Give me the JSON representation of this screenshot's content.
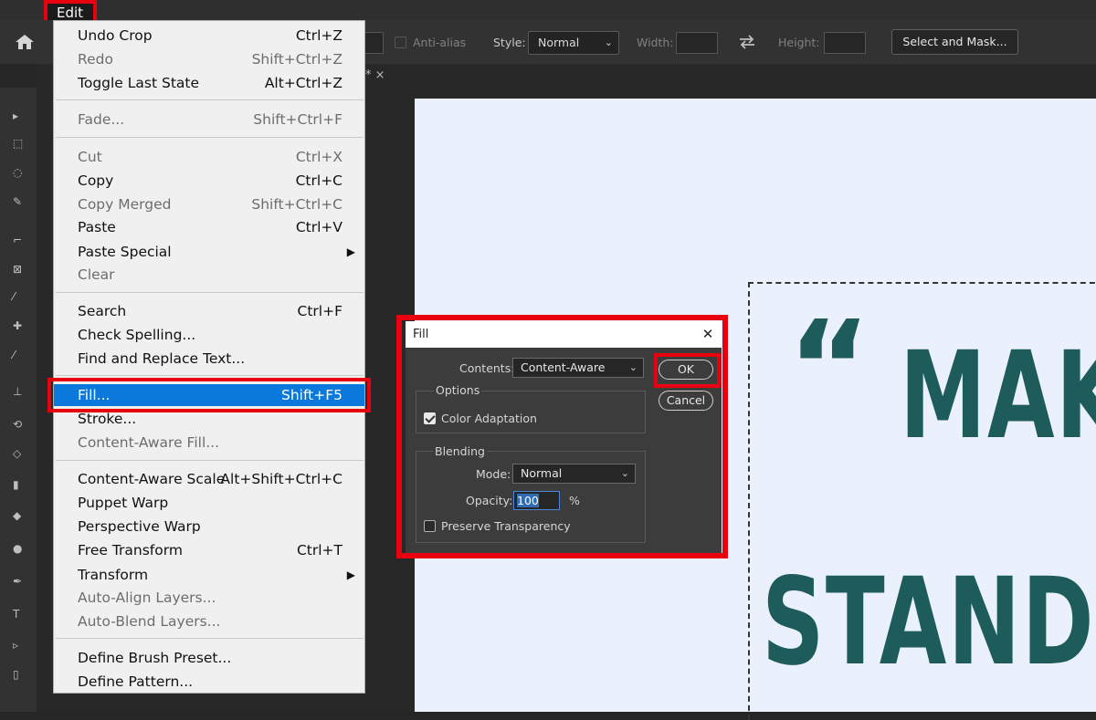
{
  "menubar": {
    "edit_label": "Edit"
  },
  "options_bar": {
    "anti_alias_label": "Anti-alias",
    "style_label": "Style:",
    "style_value": "Normal",
    "width_label": "Width:",
    "height_label": "Height:",
    "select_mask_label": "Select and Mask..."
  },
  "tabbar": {
    "stub": "* ×"
  },
  "edit_menu": {
    "items": [
      {
        "label": "Undo Crop",
        "shortcut": "Ctrl+Z",
        "enabled": true
      },
      {
        "label": "Redo",
        "shortcut": "Shift+Ctrl+Z",
        "enabled": false
      },
      {
        "label": "Toggle Last State",
        "shortcut": "Alt+Ctrl+Z",
        "enabled": true
      },
      {
        "label": "Fade...",
        "shortcut": "Shift+Ctrl+F",
        "enabled": false
      },
      {
        "label": "Cut",
        "shortcut": "Ctrl+X",
        "enabled": false
      },
      {
        "label": "Copy",
        "shortcut": "Ctrl+C",
        "enabled": true
      },
      {
        "label": "Copy Merged",
        "shortcut": "Shift+Ctrl+C",
        "enabled": false
      },
      {
        "label": "Paste",
        "shortcut": "Ctrl+V",
        "enabled": true
      },
      {
        "label": "Paste Special",
        "shortcut": "",
        "enabled": true,
        "submenu": true
      },
      {
        "label": "Clear",
        "shortcut": "",
        "enabled": false
      },
      {
        "label": "Search",
        "shortcut": "Ctrl+F",
        "enabled": true
      },
      {
        "label": "Check Spelling...",
        "shortcut": "",
        "enabled": true
      },
      {
        "label": "Find and Replace Text...",
        "shortcut": "",
        "enabled": true
      },
      {
        "label": "Fill...",
        "shortcut": "Shift+F5",
        "enabled": true,
        "highlighted": true
      },
      {
        "label": "Stroke...",
        "shortcut": "",
        "enabled": true
      },
      {
        "label": "Content-Aware Fill...",
        "shortcut": "",
        "enabled": false
      },
      {
        "label": "Content-Aware Scale",
        "shortcut": "Alt+Shift+Ctrl+C",
        "enabled": true
      },
      {
        "label": "Puppet Warp",
        "shortcut": "",
        "enabled": true
      },
      {
        "label": "Perspective Warp",
        "shortcut": "",
        "enabled": true
      },
      {
        "label": "Free Transform",
        "shortcut": "Ctrl+T",
        "enabled": true
      },
      {
        "label": "Transform",
        "shortcut": "",
        "enabled": true,
        "submenu": true
      },
      {
        "label": "Auto-Align Layers...",
        "shortcut": "",
        "enabled": false
      },
      {
        "label": "Auto-Blend Layers...",
        "shortcut": "",
        "enabled": false
      },
      {
        "label": "Define Brush Preset...",
        "shortcut": "",
        "enabled": true
      },
      {
        "label": "Define Pattern...",
        "shortcut": "",
        "enabled": true
      }
    ]
  },
  "fill_dialog": {
    "title": "Fill",
    "close_glyph": "✕",
    "contents_label": "Contents:",
    "contents_value": "Content-Aware",
    "options_label": "Options",
    "color_adaptation_label": "Color Adaptation",
    "color_adaptation_checked": true,
    "blending_label": "Blending",
    "mode_label": "Mode:",
    "mode_value": "Normal",
    "opacity_label": "Opacity:",
    "opacity_value": "100",
    "opacity_unit": "%",
    "preserve_transparency_label": "Preserve Transparency",
    "preserve_transparency_checked": false,
    "ok_label": "OK",
    "cancel_label": "Cancel"
  },
  "canvas": {
    "quote_mark": "“",
    "line1": "MAK",
    "line2": "STAND"
  },
  "colors": {
    "highlight_red": "#e8000f",
    "menu_selected": "#0a79db",
    "canvas_bg": "#eaf1fc",
    "text_teal": "#1e5c5c"
  }
}
